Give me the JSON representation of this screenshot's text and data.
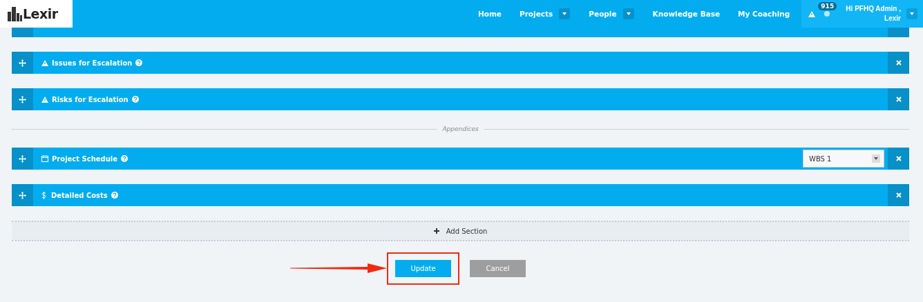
{
  "header": {
    "logo": "Lexir",
    "nav": [
      {
        "label": "Home",
        "dropdown": false
      },
      {
        "label": "Projects",
        "dropdown": true
      },
      {
        "label": "People",
        "dropdown": true
      },
      {
        "label": "Knowledge Base",
        "dropdown": false
      },
      {
        "label": "My Coaching",
        "dropdown": false
      }
    ],
    "alert_count": "915",
    "user": "Hi PFHQ Admin ,\nLexir"
  },
  "sections": [
    {
      "obscured": true
    },
    {
      "obscured": false,
      "kind": "warning",
      "title": "Issues for Escalation"
    },
    {
      "obscured": false,
      "kind": "warning",
      "title": "Risks for Escalation"
    }
  ],
  "appendices": {
    "label": "Appendices",
    "sections": [
      {
        "obscured": false,
        "kind": "schedule",
        "title": "Project Schedule",
        "select": {
          "value": "WBS 1"
        }
      },
      {
        "obscured": false,
        "kind": "costs",
        "title": "Detailed Costs"
      }
    ]
  },
  "add_section": "Add Section",
  "actions": [
    {
      "label": "Update",
      "kind": "primary",
      "highlighted": true
    },
    {
      "label": "Cancel",
      "kind": "secondary",
      "highlighted": false
    }
  ]
}
